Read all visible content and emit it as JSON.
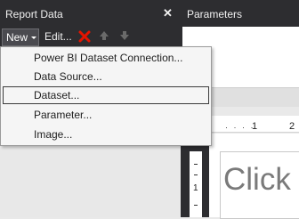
{
  "left_panel": {
    "title": "Report Data",
    "close_glyph": "✕",
    "toolbar": {
      "new_label": "New",
      "edit_label": "Edit...",
      "delete_icon": "red-x-icon",
      "up_icon": "up-arrow-icon",
      "down_icon": "down-arrow-icon"
    }
  },
  "menu": {
    "items": [
      {
        "label": "Power BI Dataset Connection..."
      },
      {
        "label": "Data Source..."
      },
      {
        "label": "Dataset..."
      },
      {
        "label": "Parameter..."
      },
      {
        "label": "Image..."
      }
    ],
    "highlighted_index": 2
  },
  "right_panel": {
    "title": "Parameters",
    "ruler_dots": "· · · ·",
    "ruler_num_1": "1",
    "ruler_num_2": "2",
    "left_ruler_num": "1",
    "canvas_text": "Click t"
  },
  "colors": {
    "panel_dark": "#2d2d30",
    "delete_red": "#e51400",
    "menu_bg": "#f5f5f5"
  }
}
